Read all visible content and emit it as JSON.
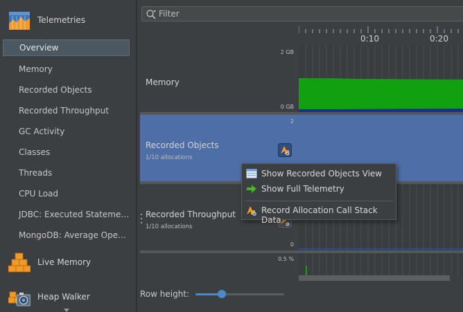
{
  "sidebar": {
    "telemetries_label": "Telemetries",
    "items": [
      {
        "label": "Overview",
        "active": true
      },
      {
        "label": "Memory"
      },
      {
        "label": "Recorded Objects"
      },
      {
        "label": "Recorded Throughput"
      },
      {
        "label": "GC Activity"
      },
      {
        "label": "Classes"
      },
      {
        "label": "Threads"
      },
      {
        "label": "CPU Load"
      },
      {
        "label": "JDBC: Executed Statements"
      },
      {
        "label": "MongoDB: Average Operations"
      }
    ],
    "live_memory_label": "Live Memory",
    "heap_walker_label": "Heap Walker"
  },
  "filter": {
    "placeholder": "Filter"
  },
  "timeline": {
    "ticks": [
      "0:10",
      "0:20"
    ]
  },
  "rows": {
    "memory": {
      "title": "Memory",
      "axis_top": "2 GB",
      "axis_bottom": "0 GB"
    },
    "recorded_objects": {
      "title": "Recorded Objects",
      "subtitle": "1/10 allocations",
      "axis_top": "2"
    },
    "recorded_throughput": {
      "title": "Recorded Throughput",
      "subtitle": "1/10 allocations",
      "axis_bottom": "0"
    },
    "gc_activity": {
      "axis_top": "0.5 %"
    }
  },
  "context_menu": {
    "items": [
      {
        "label": "Show Recorded Objects View",
        "icon": "objects-view-icon"
      },
      {
        "label": "Show Full Telemetry",
        "icon": "green-arrow-icon"
      },
      {
        "label": "Record Allocation Call Stack Data",
        "icon": "allocation-stack-icon"
      }
    ]
  },
  "footer": {
    "row_height_label": "Row height:",
    "slider_value_fraction": 0.3
  },
  "colors": {
    "accent": "#4a88c7",
    "selection": "#4e6ea8",
    "memory_fill": "#10a010",
    "menu_bg": "#3c3f41"
  }
}
